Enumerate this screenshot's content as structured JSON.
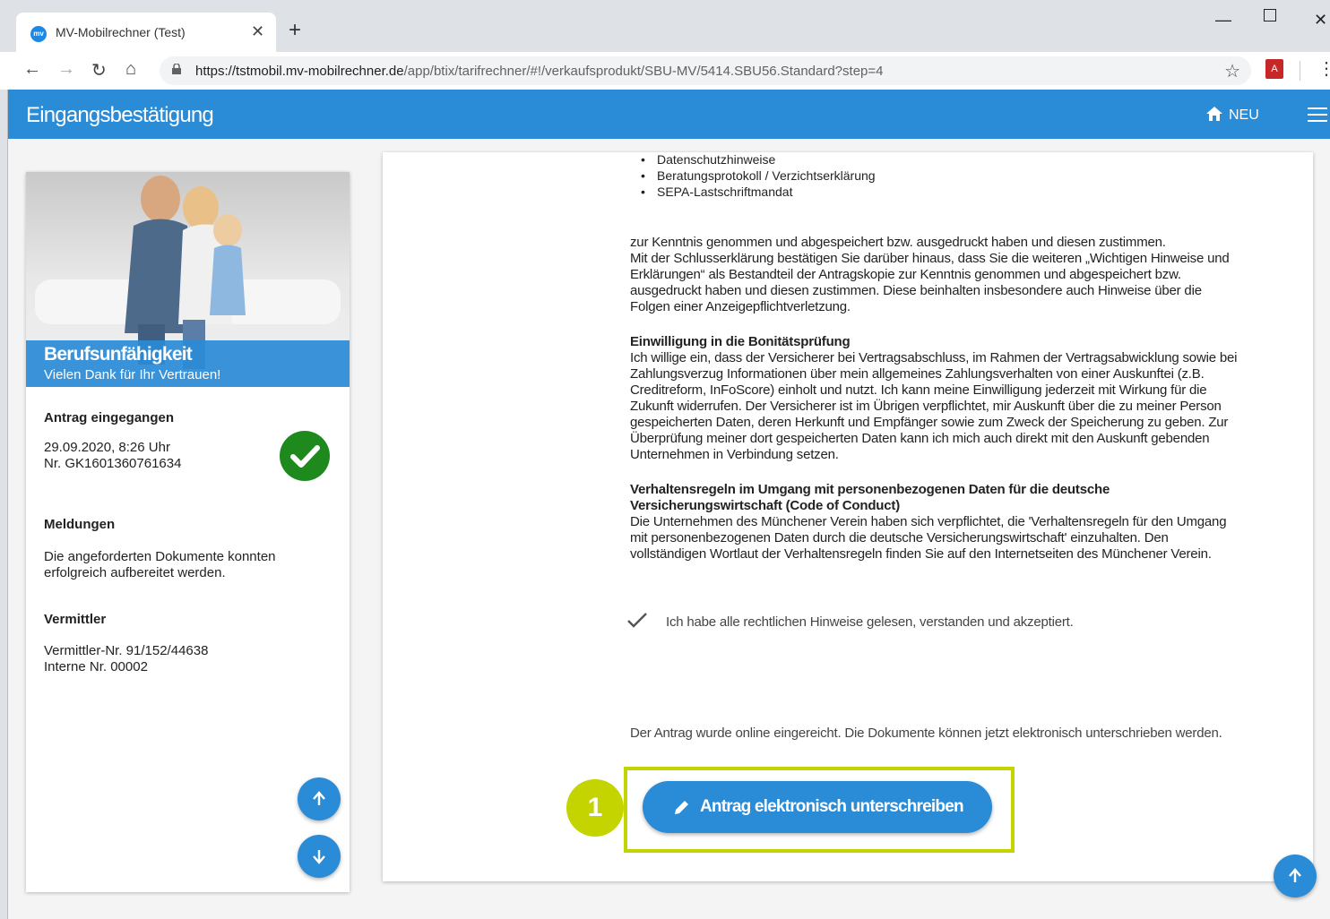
{
  "browser": {
    "tab_title": "MV-Mobilrechner (Test)",
    "favicon_text": "mv",
    "url_domain": "https://tstmobil.mv-mobilrechner.de",
    "url_path": "/app/btix/tarifrechner/#!/verkaufsprodukt/SBU-MV/5414.SBU56.Standard?step=4"
  },
  "appbar": {
    "title": "Eingangsbestätigung",
    "neu_label": "NEU"
  },
  "sidebar": {
    "hero_title": "Berufsunfähigkeit",
    "hero_subtitle": "Vielen Dank für Ihr Vertrauen!",
    "antrag_heading": "Antrag eingegangen",
    "antrag_date": "29.09.2020, 8:26 Uhr",
    "antrag_nr": "Nr. GK1601360761634",
    "meldungen_heading": "Meldungen",
    "meldungen_line1": "Die angeforderten Dokumente konnten",
    "meldungen_line2": "erfolgreich aufbereitet werden.",
    "vermittler_heading": "Vermittler",
    "vermittler_nr": "Vermittler-Nr. 91/152/44638",
    "interne_nr": "Interne Nr. 00002"
  },
  "main": {
    "bullets": [
      "Datenschutzhinweise",
      "Beratungsprotokoll / Verzichtserklärung",
      "SEPA-Lastschriftmandat"
    ],
    "para1": [
      "zur Kenntnis genommen und abgespeichert bzw. ausgedruckt haben und diesen zustimmen.",
      "Mit der Schlusserklärung bestätigen Sie darüber hinaus, dass Sie die weiteren „Wichtigen Hinweise und",
      "Erklärungen“ als Bestandteil der Antragskopie zur Kenntnis genommen und abgespeichert bzw.",
      "ausgedruckt haben und diesen zustimmen. Diese beinhalten insbesondere auch Hinweise über die",
      "Folgen einer Anzeigepflichtverletzung."
    ],
    "bonitaet_heading": "Einwilligung in die Bonitätsprüfung",
    "bonitaet_text": [
      "Ich willige ein, dass der Versicherer bei Vertragsabschluss, im Rahmen der Vertragsabwicklung sowie bei",
      "Zahlungsverzug Informationen über mein allgemeines Zahlungsverhalten von einer Auskunftei (z.B.",
      "Creditreform, InFoScore) einholt und nutzt. Ich kann meine Einwilligung jederzeit mit Wirkung für die",
      "Zukunft widerrufen. Der Versicherer ist im Übrigen verpflichtet, mir Auskunft über die zu meiner Person",
      "gespeicherten Daten, deren Herkunft und Empfänger sowie zum Zweck der Speicherung zu geben. Zur",
      "Überprüfung meiner dort gespeicherten Daten kann ich mich auch direkt mit den Auskunft gebenden",
      "Unternehmen in Verbindung setzen."
    ],
    "coc_heading_1": "Verhaltensregeln im Umgang mit personenbezogenen Daten für die deutsche",
    "coc_heading_2": "Versicherungswirtschaft (Code of Conduct)",
    "coc_text": [
      "Die Unternehmen des Münchener Verein haben sich verpflichtet, die 'Verhaltensregeln für den Umgang",
      "mit personenbezogenen Daten durch die deutsche Versicherungswirtschaft' einzuhalten. Den",
      "vollständigen Wortlaut der Verhaltensregeln finden Sie auf den Internetseiten des Münchener Verein."
    ],
    "ack_text": "Ich habe alle rechtlichen Hinweise gelesen, verstanden und akzeptiert.",
    "submitted_text": "Der Antrag wurde online eingereicht. Die Dokumente können jetzt elektronisch unterschrieben werden.",
    "sign_button": "Antrag elektronisch unterschreiben",
    "step_badge": "1"
  },
  "colors": {
    "primary": "#2a8bd6",
    "success": "#1e8a1e",
    "highlight": "#c3d400"
  }
}
